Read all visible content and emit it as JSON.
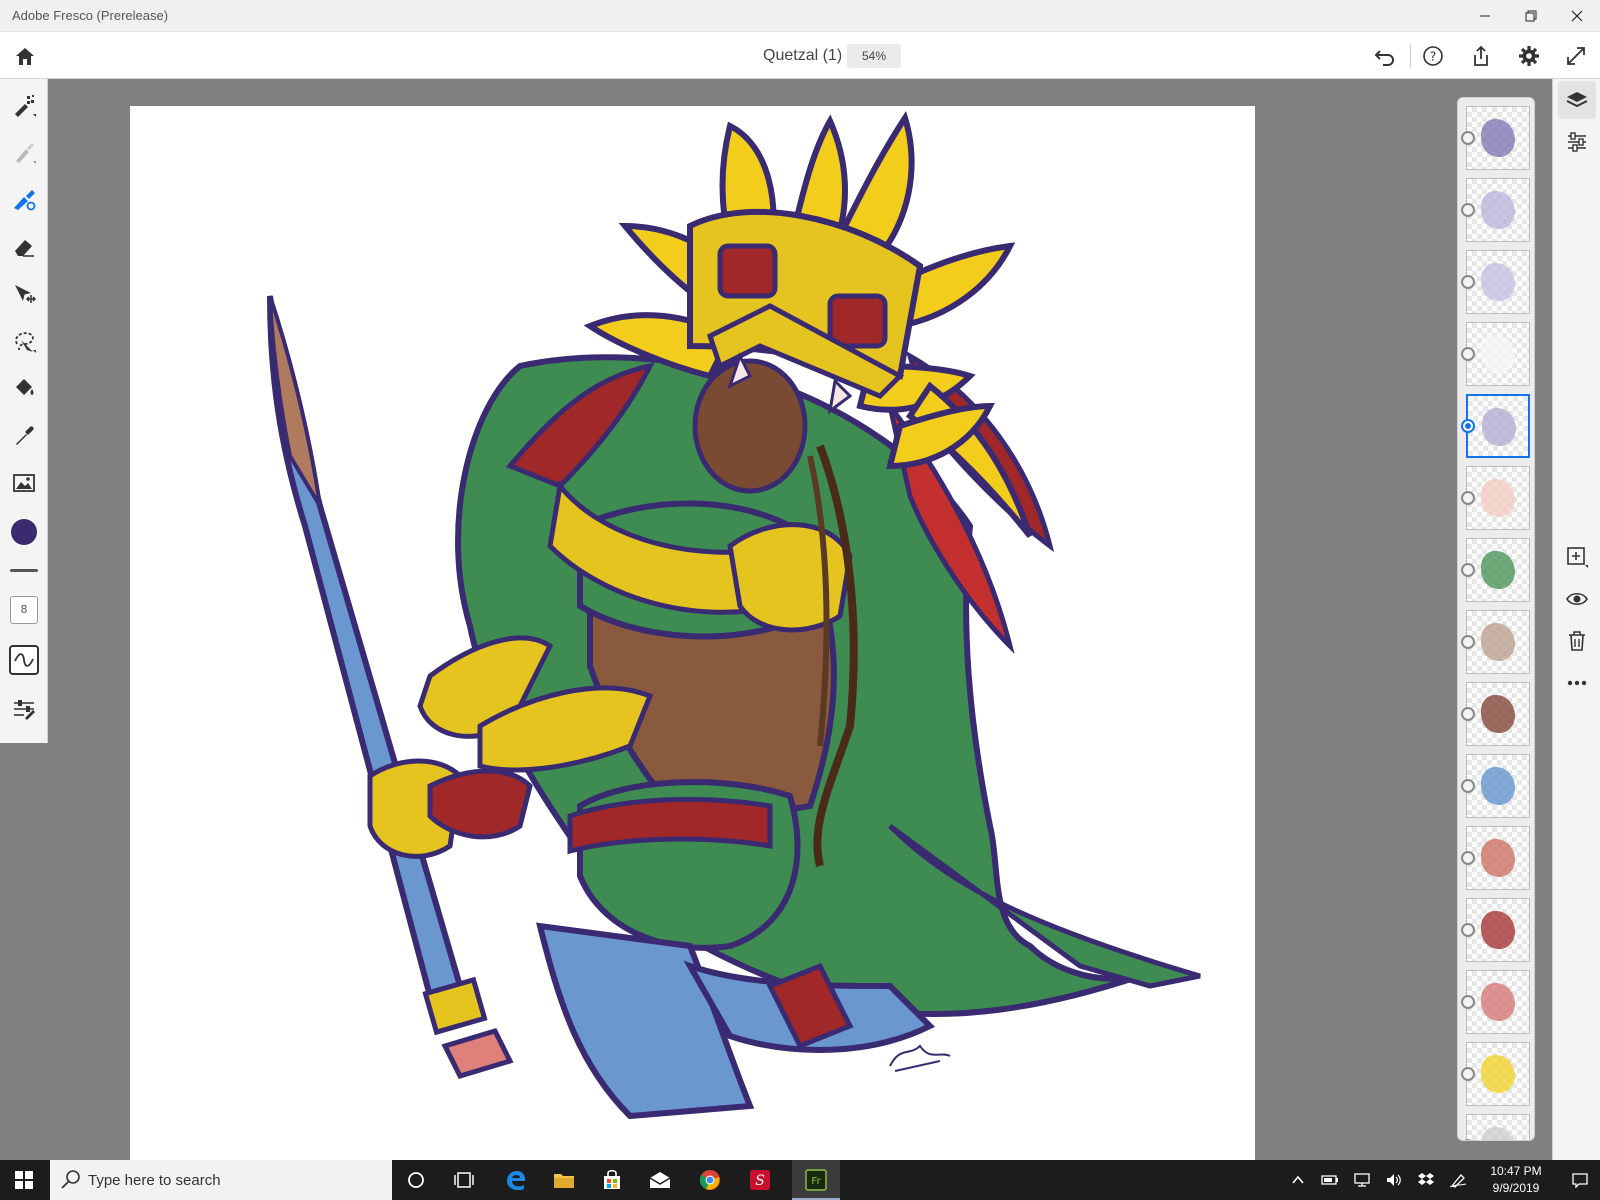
{
  "window": {
    "title": "Adobe Fresco (Prerelease)"
  },
  "header": {
    "document_title": "Quetzal (1)",
    "zoom": "54%"
  },
  "toolbar": {
    "brush_size": "8",
    "color": "#3a2a72"
  },
  "layers": {
    "count_visible": 15,
    "selected_index": 4,
    "thumb_colors": [
      "#7a6fb0",
      "#b8b0d8",
      "#c2bce0",
      "#f6f6f6",
      "#b0a8d0",
      "#f3c9c0",
      "#3f8f4f",
      "#b89a8a",
      "#7a3b2a",
      "#5b8fc9",
      "#c96a5a",
      "#a02828",
      "#d47070",
      "#f0d020",
      "#cccccc"
    ]
  },
  "taskbar": {
    "search_placeholder": "Type here to search",
    "time": "10:47 PM",
    "date": "9/9/2019"
  },
  "colors": {
    "accent": "#1473e6",
    "ink": "#3a2a72"
  }
}
